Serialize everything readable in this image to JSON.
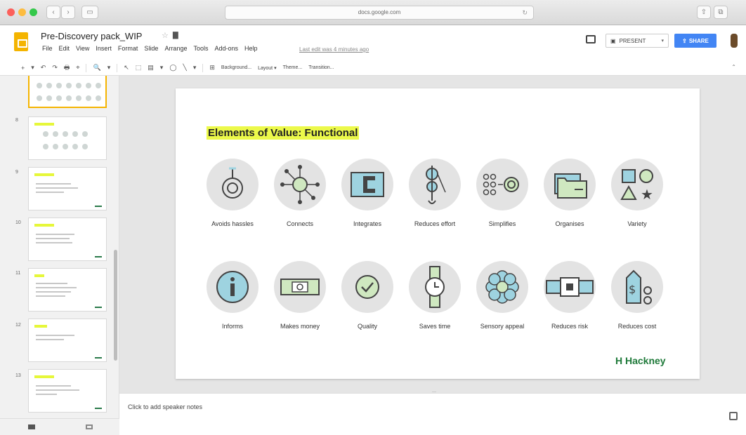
{
  "browser": {
    "url": "docs.google.com",
    "nav_back": "‹",
    "nav_fwd": "›",
    "nav_sidebar": "▭",
    "right_icons": [
      "⇧",
      "⧉"
    ]
  },
  "app": {
    "title": "Pre-Discovery pack_WIP",
    "menu": [
      "File",
      "Edit",
      "View",
      "Insert",
      "Format",
      "Slide",
      "Arrange",
      "Tools",
      "Add-ons",
      "Help"
    ],
    "last_edit": "Last edit was 4 minutes ago",
    "present_label": "PRESENT",
    "share_label": "SHARE",
    "colors": {
      "share": "#4285f4",
      "logo": "#f4b400",
      "highlight": "#ecf94a",
      "brand_green": "#1f7a3a"
    }
  },
  "toolbar": {
    "items": [
      "+",
      "▾",
      "↶",
      "↷",
      "🖶",
      "⌖",
      "▾",
      "🔍",
      "▾",
      "↖",
      "⬚",
      "▤",
      "▾",
      "◯",
      "╲",
      "▾",
      "⊞"
    ],
    "buttons": [
      "Background...",
      "Layout ▾",
      "Theme...",
      "Transition..."
    ],
    "collapse": "⌃"
  },
  "filmstrip": {
    "slides": [
      {
        "num": ""
      },
      {
        "num": "8"
      },
      {
        "num": "9"
      },
      {
        "num": "10"
      },
      {
        "num": "11"
      },
      {
        "num": "12"
      },
      {
        "num": "13"
      }
    ]
  },
  "slide": {
    "title": "Elements of Value: Functional",
    "row1": [
      {
        "label": "Avoids hassles",
        "icon": "spiral-at-icon"
      },
      {
        "label": "Connects",
        "icon": "network-hub-icon"
      },
      {
        "label": "Integrates",
        "icon": "c-block-icon"
      },
      {
        "label": "Reduces effort",
        "icon": "pulley-icon"
      },
      {
        "label": "Simplifies",
        "icon": "dots-to-circle-icon"
      },
      {
        "label": "Organises",
        "icon": "folder-icon"
      },
      {
        "label": "Variety",
        "icon": "shapes-icon"
      }
    ],
    "row2": [
      {
        "label": "Informs",
        "icon": "info-icon"
      },
      {
        "label": "Makes money",
        "icon": "banknote-icon"
      },
      {
        "label": "Quality",
        "icon": "checkmark-icon"
      },
      {
        "label": "Saves time",
        "icon": "watch-icon"
      },
      {
        "label": "Sensory appeal",
        "icon": "flower-icon"
      },
      {
        "label": "Reduces risk",
        "icon": "seatbelt-icon"
      },
      {
        "label": "Reduces cost",
        "icon": "price-tag-icon"
      }
    ],
    "logo": "H Hackney"
  },
  "notes": {
    "placeholder": "Click to add speaker notes"
  }
}
